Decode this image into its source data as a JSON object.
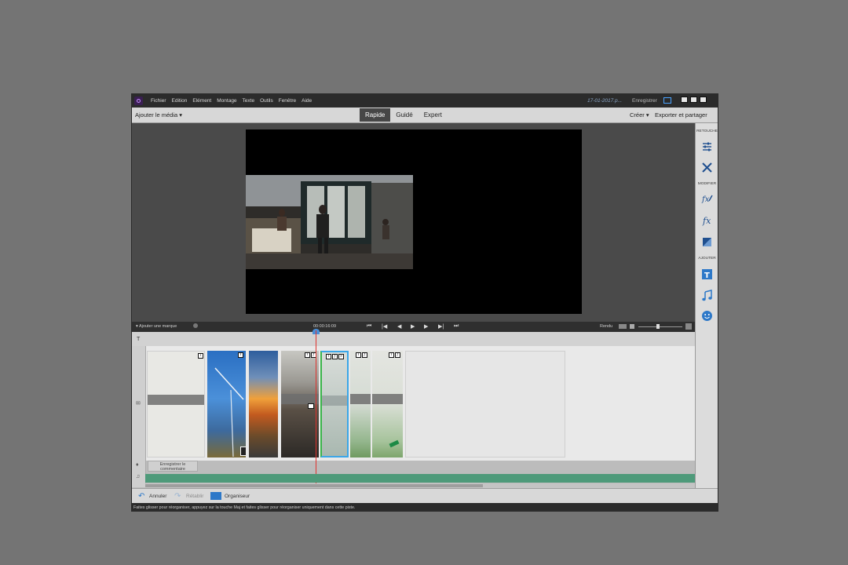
{
  "titlebar": {
    "menu": [
      "Fichier",
      "Edition",
      "Elément",
      "Montage",
      "Texte",
      "Outils",
      "Fenêtre",
      "Aide"
    ],
    "document_title": "17-01-2017.p...",
    "signin": "Enregistrer"
  },
  "modebar": {
    "add_media": "Ajouter le média ▾",
    "tabs": [
      {
        "label": "Rapide",
        "active": true
      },
      {
        "label": "Guidé",
        "active": false
      },
      {
        "label": "Expert",
        "active": false
      }
    ],
    "create": "Créer ▾",
    "export": "Exporter et partager"
  },
  "right_panel": {
    "retouche": "RETOUCHE",
    "modifier": "MODIFIER",
    "ajouter": "AJOUTER"
  },
  "transport": {
    "add_marker": "Ajouter une marque",
    "timecode": "00:00:16:09",
    "render": "Rendu"
  },
  "timeline": {
    "narration": "Enregistrer le commentaire"
  },
  "bottombar": {
    "undo": "Annuler",
    "redo": "Rétablir",
    "organizer": "Organiseur"
  },
  "status": {
    "text": "Faites glisser pour réorganiser, appuyez sur la touche Maj et faites glisser pour réorganiser uniquement dans cette piste."
  },
  "colors": {
    "accent": "#4a8fd8",
    "audio_track": "#4e9a7a",
    "playhead": "#e0342f",
    "selected_clip": "#3aa6e8"
  }
}
